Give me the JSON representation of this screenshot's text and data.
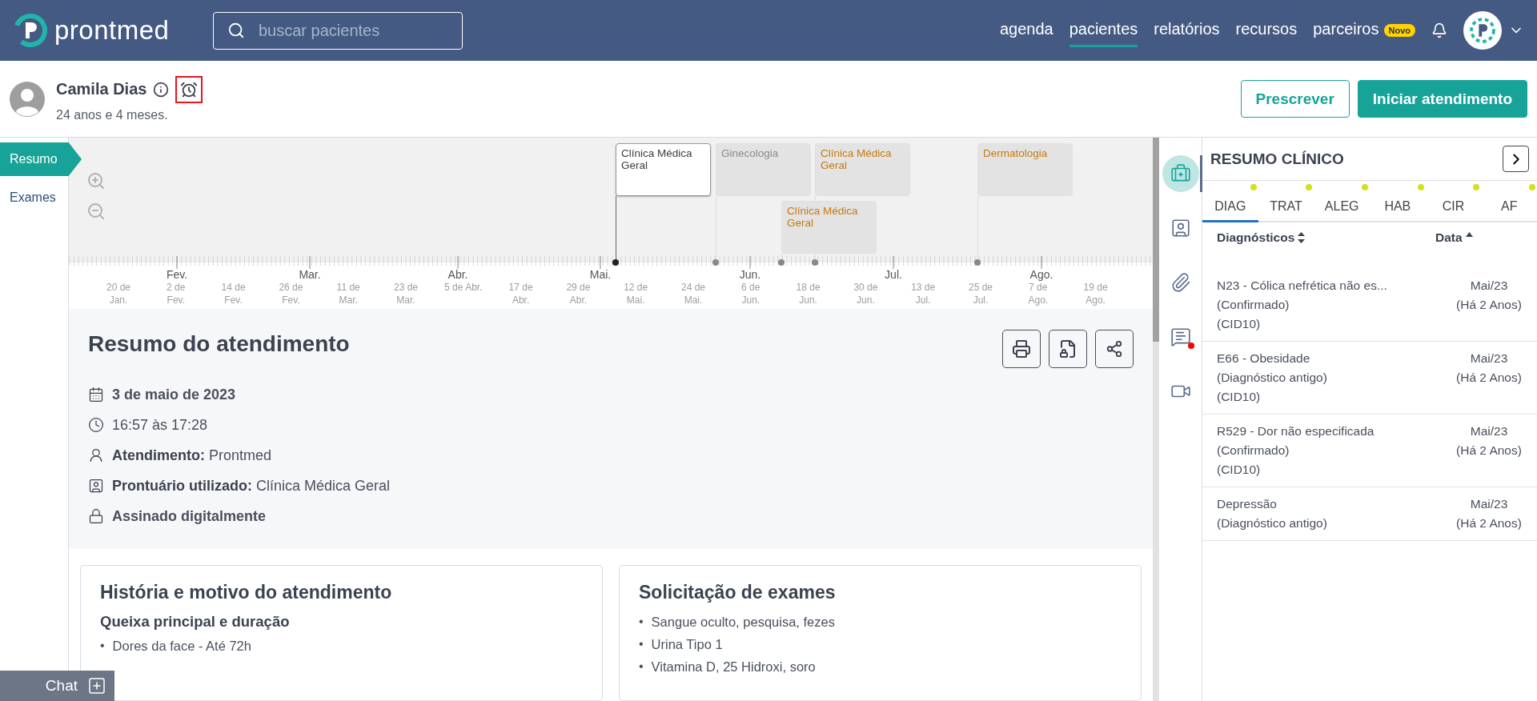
{
  "header": {
    "brand": "prontmed",
    "search": {
      "placeholder": "buscar pacientes"
    },
    "nav": [
      {
        "label": "agenda",
        "selected": false
      },
      {
        "label": "pacientes",
        "selected": true
      },
      {
        "label": "relatórios",
        "selected": false
      },
      {
        "label": "recursos",
        "selected": false
      },
      {
        "label": "parceiros",
        "selected": false,
        "badge": "Novo"
      }
    ]
  },
  "patient": {
    "name": "Camila Dias",
    "age": "24 anos e 4 meses.",
    "alarm_highlighted": true
  },
  "actions": [
    {
      "label": "Prescrever",
      "kind": "outline"
    },
    {
      "label": "Iniciar atendimento",
      "kind": "primary"
    }
  ],
  "sidebar": {
    "items": [
      {
        "label": "Resumo",
        "selected": true
      },
      {
        "label": "Exames",
        "selected": false
      }
    ]
  },
  "timeline": {
    "events": [
      {
        "label": "Clínica Médica Geral",
        "selected": true,
        "color": "#3d3d3d"
      },
      {
        "label": "Ginecologia",
        "selected": false,
        "color": "#8a8a8a"
      },
      {
        "label": "Clínica Médica Geral",
        "selected": false,
        "color": "#c77a0c"
      },
      {
        "label": "Clínica Médica Geral",
        "selected": false,
        "color": "#c77a0c"
      },
      {
        "label": "Dermatologia",
        "selected": false,
        "color": "#c77a0c"
      }
    ],
    "ticks": [
      "20 de\nJan.",
      "2 de\nFev.",
      "14 de\nFev.",
      "26 de\nFev.",
      "11 de\nMar.",
      "23 de\nMar.",
      "5 de Abr.",
      "17 de\nAbr.",
      "29 de\nAbr.",
      "12 de\nMai.",
      "24 de\nMai.",
      "6 de\nJun.",
      "18 de\nJun.",
      "30 de\nJun.",
      "13 de\nJul.",
      "25 de\nJul.",
      "7 de\nAgo.",
      "19 de\nAgo."
    ],
    "months": [
      "Fev.",
      "Mar.",
      "Abr.",
      "Mai.",
      "Jun.",
      "Jul.",
      "Ago."
    ]
  },
  "summary": {
    "title": "Resumo do atendimento",
    "details": [
      {
        "kind": "date",
        "text": "3 de maio de 2023"
      },
      {
        "kind": "time",
        "text": "16:57 às 17:28"
      },
      {
        "kind": "attendant",
        "text": "**Atendimento:** Prontmed"
      },
      {
        "kind": "record",
        "text": "**Prontuário utilizado:** Clínica Médica Geral"
      },
      {
        "kind": "signed",
        "text": "Assinado digitalmente"
      }
    ]
  },
  "cards": [
    {
      "title": "História e motivo do atendimento",
      "subtitle": "Queixa principal e duração",
      "marker": "•",
      "items": [
        "Dores da face - Até 72h"
      ]
    },
    {
      "title": "Solicitação de exames",
      "marker": "•",
      "items": [
        "Sangue oculto, pesquisa, fezes",
        "Urina Tipo 1",
        "Vitamina D, 25 Hidroxi, soro"
      ]
    }
  ],
  "chat": {
    "label": "Chat"
  },
  "rail": [
    {
      "kind": "clinical",
      "selected": true,
      "alert": false
    },
    {
      "kind": "record",
      "selected": false,
      "alert": false
    },
    {
      "kind": "attachments",
      "selected": false,
      "alert": false
    },
    {
      "kind": "messages",
      "selected": false,
      "alert": true
    },
    {
      "kind": "video",
      "selected": false,
      "alert": false
    }
  ],
  "clinical_summary": {
    "title": "RESUMO CLÍNICO",
    "tabs": [
      {
        "label": "DIAG",
        "selected": true,
        "dot": true
      },
      {
        "label": "TRAT",
        "selected": false,
        "dot": true
      },
      {
        "label": "ALEG",
        "selected": false,
        "dot": true
      },
      {
        "label": "HAB",
        "selected": false,
        "dot": true
      },
      {
        "label": "CIR",
        "selected": false,
        "dot": true
      },
      {
        "label": "AF",
        "selected": false,
        "dot": true
      }
    ],
    "columns": [
      "Diagnósticos",
      "Data"
    ],
    "rows": [
      {
        "diagnosis": "N23 - Cólica nefrética não es...\n(Confirmado)\n(CID10)",
        "date": "Mai/23\n(Há 2 Anos)"
      },
      {
        "diagnosis": "E66 - Obesidade\n(Diagnóstico antigo)\n(CID10)",
        "date": "Mai/23\n(Há 2 Anos)"
      },
      {
        "diagnosis": "R529 - Dor não especificada\n(Confirmado)\n(CID10)",
        "date": "Mai/23\n(Há 2 Anos)"
      },
      {
        "diagnosis": "Depressão\n(Diagnóstico antigo)",
        "date": "Mai/23\n(Há 2 Anos)"
      }
    ]
  }
}
